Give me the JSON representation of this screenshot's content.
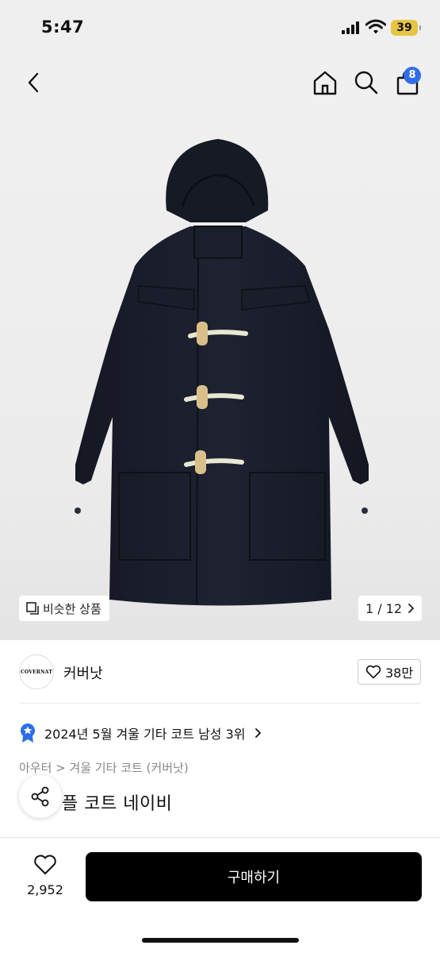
{
  "status_bar": {
    "time": "5:47",
    "battery": "39"
  },
  "header": {
    "cart_count": "8"
  },
  "gallery": {
    "similar_label": "비슷한 상품",
    "pager": "1 / 12"
  },
  "brand": {
    "logo_text": "COVERNAT",
    "name": "커버낫",
    "likes": "38만"
  },
  "ranking": {
    "text": "2024년 5월 겨울 기타 코트 남성 3위"
  },
  "product": {
    "breadcrumb": "아우터 > 겨울 기타 코트 (커버낫)",
    "title_visible": "플 코트 네이비"
  },
  "bottom_bar": {
    "wish_count": "2,952",
    "buy_label": "구매하기"
  },
  "colors": {
    "accent": "#2f6de8",
    "badge": "#2f6de8",
    "battery": "#e6c543",
    "buy_button": "#000000",
    "coat": "#1a1d2b"
  }
}
